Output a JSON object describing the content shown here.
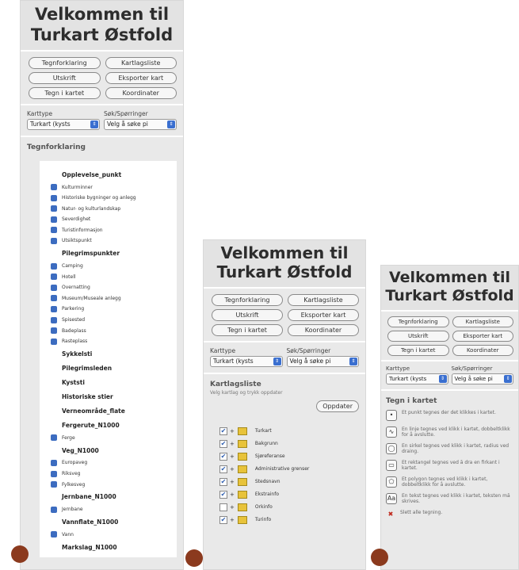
{
  "header": {
    "line1": "Velkommen til",
    "line2": "Turkart Østfold"
  },
  "buttons": {
    "tegnforklaring": "Tegnforklaring",
    "kartlagsliste": "Kartlagsliste",
    "utskrift": "Utskrift",
    "eksporter": "Eksporter kart",
    "tegn": "Tegn i kartet",
    "koordinater": "Koordinater"
  },
  "selects": {
    "karttype_label": "Karttype",
    "karttype_value": "Turkart (kysts",
    "sok_label": "Søk/Spørringer",
    "sok_value": "Velg å søke pi"
  },
  "panel1": {
    "section_title": "Tegnforklaring",
    "legend": [
      {
        "label": "Opplevelse_punkt",
        "type": "cat"
      },
      {
        "label": "Kulturminner",
        "type": "item"
      },
      {
        "label": "Historiske bygninger og anlegg",
        "type": "item"
      },
      {
        "label": "Natur- og kulturlandskap",
        "type": "item"
      },
      {
        "label": "Severdighet",
        "type": "item"
      },
      {
        "label": "Turistinformasjon",
        "type": "item"
      },
      {
        "label": "Utsiktspunkt",
        "type": "item"
      },
      {
        "label": "Pilegrimspunkter",
        "type": "cat"
      },
      {
        "label": "Camping",
        "type": "item"
      },
      {
        "label": "Hotell",
        "type": "item"
      },
      {
        "label": "Overnatting",
        "type": "item"
      },
      {
        "label": "Museum/Museale anlegg",
        "type": "item"
      },
      {
        "label": "Parkering",
        "type": "item"
      },
      {
        "label": "Spisested",
        "type": "item"
      },
      {
        "label": "Badeplass",
        "type": "item"
      },
      {
        "label": "Rasteplass",
        "type": "item"
      },
      {
        "label": "Sykkelsti",
        "type": "cat"
      },
      {
        "label": "Pilegrimsleden",
        "type": "cat"
      },
      {
        "label": "Kyststi",
        "type": "cat"
      },
      {
        "label": "Historiske stier",
        "type": "cat"
      },
      {
        "label": "Verneområde_flate",
        "type": "cat"
      },
      {
        "label": "Fergerute_N1000",
        "type": "cat"
      },
      {
        "label": "Ferge",
        "type": "item"
      },
      {
        "label": "Veg_N1000",
        "type": "cat"
      },
      {
        "label": "Europaveg",
        "type": "item"
      },
      {
        "label": "Riksveg",
        "type": "item"
      },
      {
        "label": "Fylkesveg",
        "type": "item"
      },
      {
        "label": "Jernbane_N1000",
        "type": "cat"
      },
      {
        "label": "Jernbane",
        "type": "item"
      },
      {
        "label": "Vannflate_N1000",
        "type": "cat"
      },
      {
        "label": "Vann",
        "type": "item"
      },
      {
        "label": "Markslag_N1000",
        "type": "cat"
      }
    ]
  },
  "panel2": {
    "section_title": "Kartlagsliste",
    "subtitle": "Velg kartlag og trykk oppdater",
    "update_button": "Oppdater",
    "layers": [
      {
        "label": "Turkart",
        "checked": true
      },
      {
        "label": "Bakgrunn",
        "checked": true
      },
      {
        "label": "Sjøreferanse",
        "checked": true
      },
      {
        "label": "Administrative grenser",
        "checked": true
      },
      {
        "label": "Stedsnavn",
        "checked": true
      },
      {
        "label": "Ekstrainfo",
        "checked": true
      },
      {
        "label": "Orkinfo",
        "checked": false
      },
      {
        "label": "Turinfo",
        "checked": true
      }
    ]
  },
  "panel3": {
    "section_title": "Tegn i kartet",
    "tools": [
      {
        "icon": "•",
        "text": "Et punkt tegnes der det klikkes i kartet."
      },
      {
        "icon": "∿",
        "text": "En linje tegnes ved klikk i kartet, dobbeltklikk for å avslutte."
      },
      {
        "icon": "◯",
        "text": "En sirkel tegnes ved klikk i kartet, radius ved draing."
      },
      {
        "icon": "▭",
        "text": "Et rektangel tegnes ved å dra en firkant i kartet."
      },
      {
        "icon": "⬠",
        "text": "Et polygon tegnes ved klikk i kartet, dobbeltklikk for å avslutte."
      },
      {
        "icon": "Aa",
        "text": "En tekst tegnes ved klikk i kartet, teksten må skrives."
      },
      {
        "icon": "✖",
        "text": "Slett alle tegning."
      }
    ]
  },
  "colors": {
    "panel_bg": "#e9e9e9",
    "marker": "#8b3a1e",
    "select_arrow": "#3a6fd0"
  }
}
